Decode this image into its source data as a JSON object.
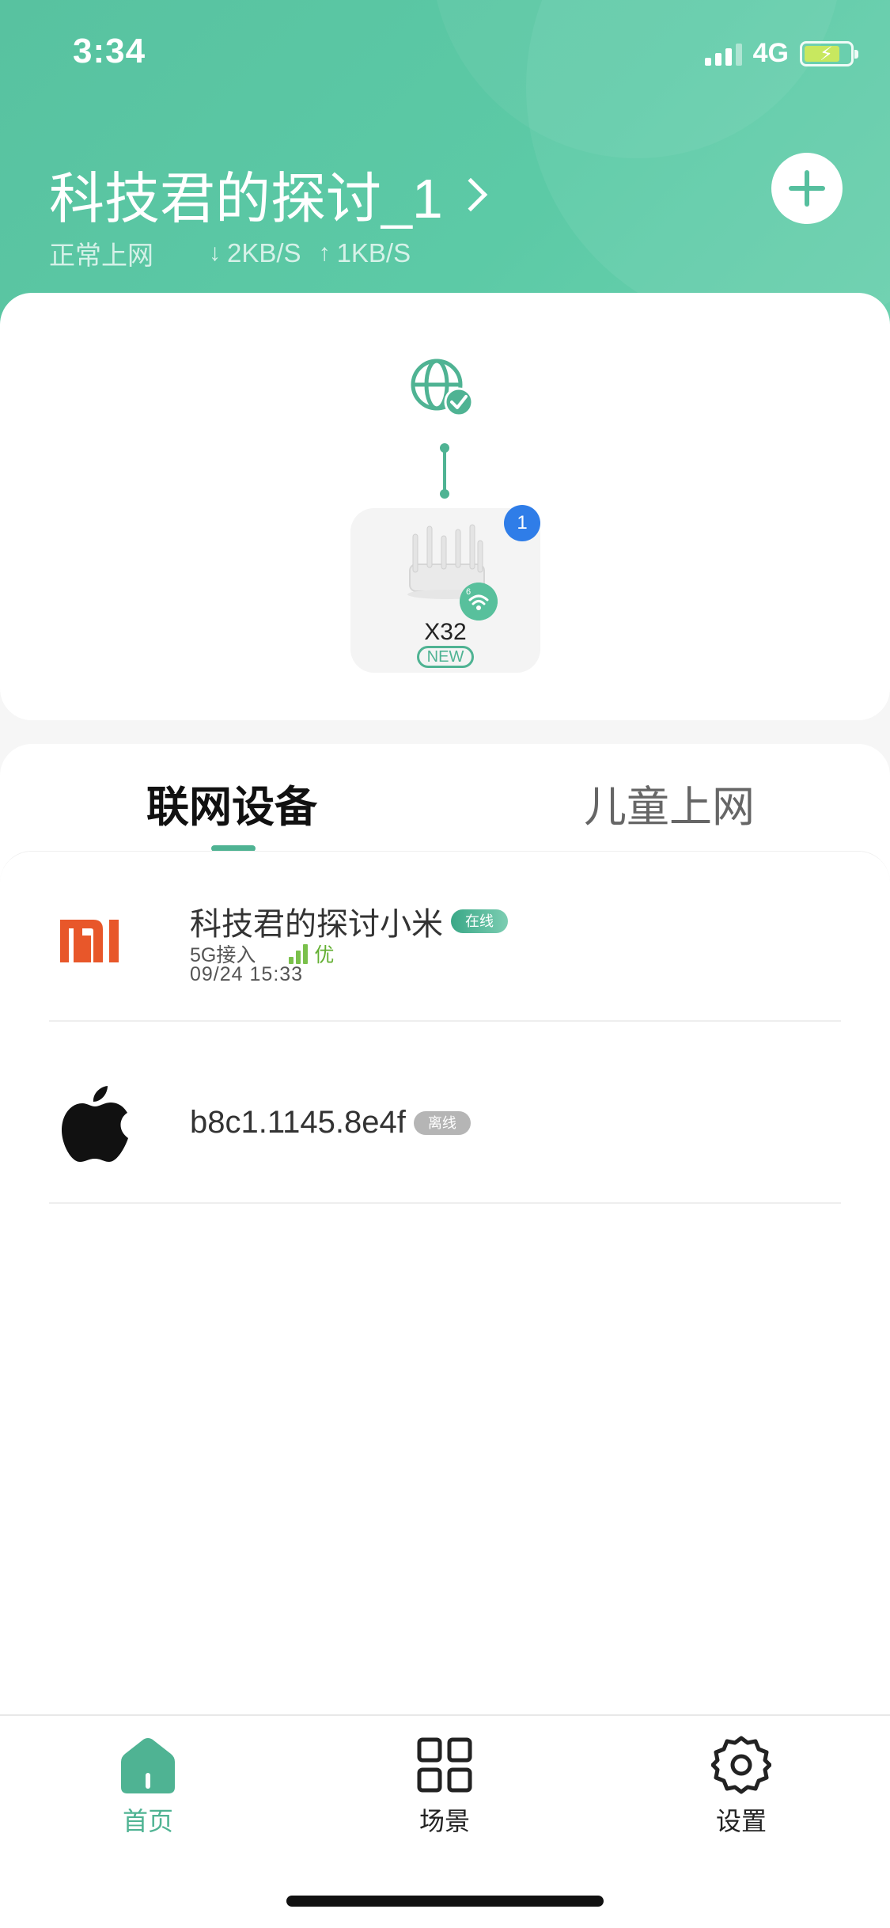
{
  "status_bar": {
    "time": "3:34",
    "network_type": "4G"
  },
  "header": {
    "router_name": "科技君的探讨_1",
    "connection_status": "正常上网",
    "download_rate": "2KB/S",
    "upload_rate": "1KB/S"
  },
  "topology": {
    "device_count": "1",
    "router_model": "X32",
    "new_badge": "NEW",
    "wifi_version": "6"
  },
  "tabs": [
    {
      "label": "联网设备",
      "active": true
    },
    {
      "label": "儿童上网",
      "active": false
    }
  ],
  "devices": [
    {
      "name": "科技君的探讨小米",
      "status": "在线",
      "access": "5G接入",
      "quality": "优",
      "time": "09/24 15:33",
      "logo": "xiaomi-logo"
    },
    {
      "name": "b8c1.1145.8e4f",
      "status": "离线",
      "logo": "apple-logo"
    }
  ],
  "bottom_nav": [
    {
      "label": "首页",
      "icon": "home-icon",
      "active": true
    },
    {
      "label": "场景",
      "icon": "grid-icon",
      "active": false
    },
    {
      "label": "设置",
      "icon": "gear-icon",
      "active": false
    }
  ],
  "colors": {
    "brand": "#58c2a0",
    "accent": "#4fb393",
    "badge_blue": "#2f7de8",
    "signal_green": "#64b033",
    "offline_gray": "#b5b5b5"
  }
}
